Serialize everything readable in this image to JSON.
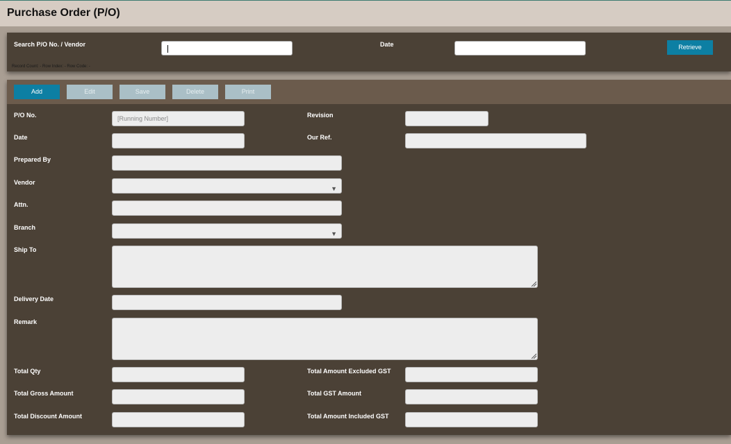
{
  "page_title": "Purchase Order (P/O)",
  "search": {
    "label": "Search P/O No. / Vendor",
    "value": "",
    "date_label": "Date",
    "date_value": "",
    "retrieve_label": "Retrieve",
    "record_info": "Record Count: - Row Index: - Row Code: -"
  },
  "toolbar": {
    "add": "Add",
    "edit": "Edit",
    "save": "Save",
    "delete": "Delete",
    "print": "Print"
  },
  "form": {
    "po_no_label": "P/O No.",
    "po_no_placeholder": "[Running Number]",
    "revision_label": "Revision",
    "date_label": "Date",
    "our_ref_label": "Our Ref.",
    "prepared_by_label": "Prepared By",
    "vendor_label": "Vendor",
    "attn_label": "Attn.",
    "branch_label": "Branch",
    "ship_to_label": "Ship To",
    "delivery_date_label": "Delivery Date",
    "remark_label": "Remark",
    "total_qty_label": "Total Qty",
    "total_gross_label": "Total Gross Amount",
    "total_discount_label": "Total Discount Amount",
    "total_excl_gst_label": "Total Amount Excluded GST",
    "total_gst_label": "Total GST Amount",
    "total_incl_gst_label": "Total Amount Included GST"
  },
  "colors": {
    "panel": "#4b4136",
    "toolbar": "#6b5b4c",
    "accent": "#0d7fa3",
    "disabled_button": "#aabfc6"
  }
}
